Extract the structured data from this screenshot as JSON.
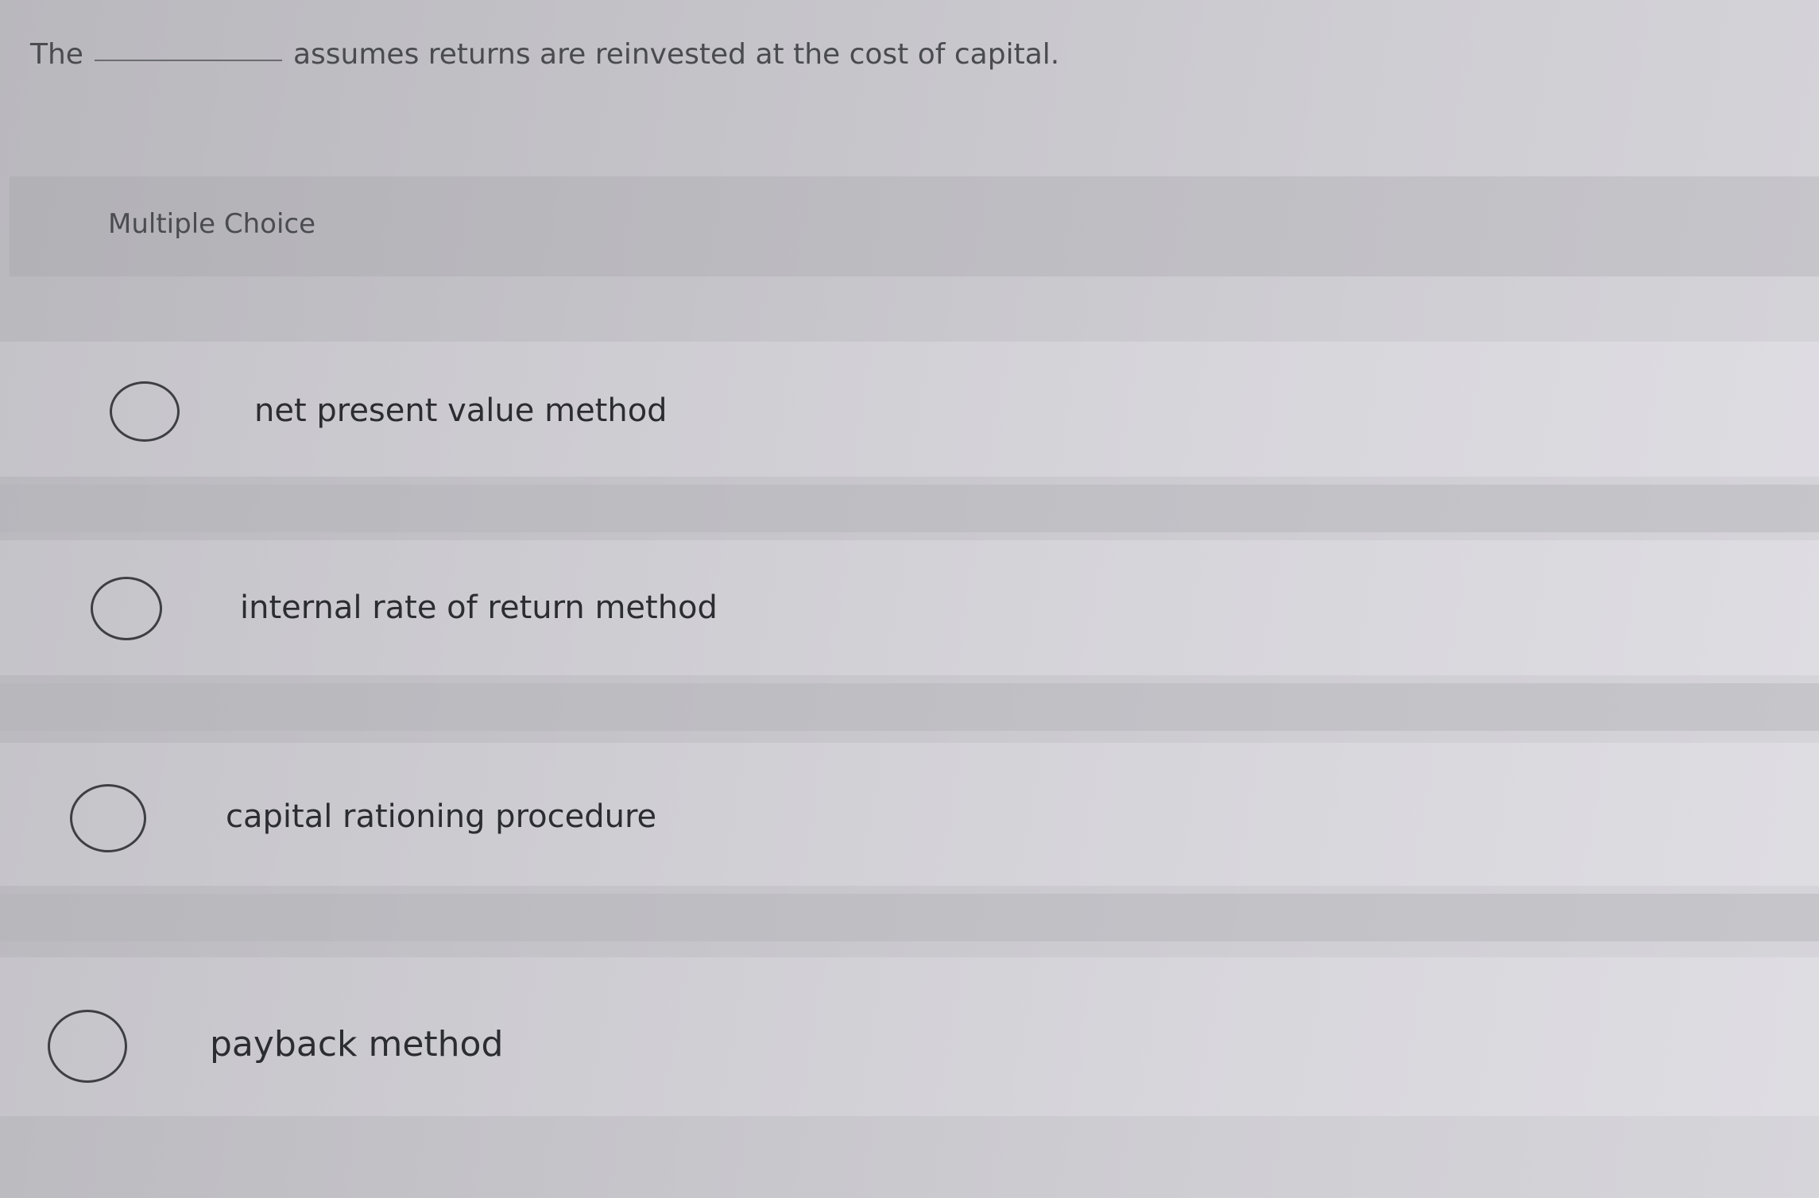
{
  "question": {
    "prefix": "The",
    "suffix": "assumes returns are reinvested at the cost of capital."
  },
  "section_label": "Multiple Choice",
  "options": [
    {
      "label": "net present value method",
      "selected": false
    },
    {
      "label": "internal rate of return method",
      "selected": false
    },
    {
      "label": "capital rationing procedure",
      "selected": false
    },
    {
      "label": "payback method",
      "selected": false
    }
  ]
}
